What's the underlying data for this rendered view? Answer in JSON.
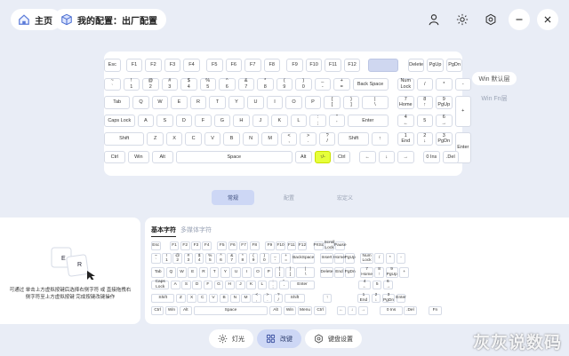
{
  "header": {
    "home_label": "主页",
    "profile_label": "我的配置：出厂配置"
  },
  "icons": {
    "home": "home-icon",
    "profile": "cube-icon",
    "user": "user-icon",
    "brightness": "sun-icon",
    "settings": "gear-icon",
    "minimize": "minimize-icon",
    "close": "close-icon"
  },
  "layers": {
    "active": "Win 默认层",
    "idle": "Win Fn层"
  },
  "tabs": [
    {
      "label": "常规",
      "active": true
    },
    {
      "label": "配置",
      "active": false
    },
    {
      "label": "宏定义",
      "active": false
    }
  ],
  "main_keys": [
    [
      "Esc",
      "F1",
      "F2",
      "F3",
      "F4",
      "F5",
      "F6",
      "F7",
      "F8",
      "F9",
      "F10",
      "F11",
      "F12",
      "",
      "Delete",
      "PgUp",
      "PgDn"
    ],
    [
      "~\n`",
      "!\n1",
      "@\n2",
      "#\n3",
      "$\n4",
      "%\n5",
      "^\n6",
      "&\n7",
      "*\n8",
      "(\n9",
      ")\n0",
      "_\n-",
      "+\n=",
      "Back Space",
      "Num\nLock",
      "/",
      "*",
      "-"
    ],
    [
      "Tab",
      "Q",
      "W",
      "E",
      "R",
      "T",
      "Y",
      "U",
      "I",
      "O",
      "P",
      "{\n[",
      "}\n]",
      "|\n\\",
      "7\nHome",
      "8\n↑",
      "9\nPgUp",
      "+"
    ],
    [
      "Caps Lock",
      "A",
      "S",
      "D",
      "F",
      "G",
      "H",
      "J",
      "K",
      "L",
      ":\n;",
      "\"\n'",
      "Enter",
      "4\n←",
      "5",
      "6\n→"
    ],
    [
      "Shift",
      "Z",
      "X",
      "C",
      "V",
      "B",
      "N",
      "M",
      "<\n,",
      ">\n.",
      "?\n/",
      "Shift",
      "↑",
      "1\nEnd",
      "2\n↓",
      "3\nPgDn",
      "Enter"
    ],
    [
      "Ctrl",
      "Win",
      "Alt",
      "Space",
      "Alt",
      "↑/-",
      "Ctrl",
      "←",
      "↓",
      "→",
      "0 Ins",
      ".Del"
    ]
  ],
  "left_panel": {
    "hint": "可通过 单击上方虚拟按键后选择右侧字符 或 直接拖拽右侧字符至上方虚拟按键 完成按键改键操作",
    "demo_keys": [
      "E",
      "R"
    ]
  },
  "right_panel": {
    "subtabs": [
      "基本字符",
      "多媒体字符"
    ],
    "row1": [
      "Esc",
      "F1",
      "F2",
      "F3",
      "F4",
      "F5",
      "F6",
      "F7",
      "F8",
      "F9",
      "F10",
      "F11",
      "F12",
      "PrtSc",
      "Scroll\nLock",
      "Pause"
    ],
    "row2": [
      "~\n`",
      "!\n1",
      "@\n2",
      "#\n3",
      "$\n4",
      "%\n5",
      "^\n6",
      "&\n7",
      "*\n8",
      "(\n9",
      ")\n0",
      "_\n-",
      "+\n=",
      "BackSpace",
      "Insert",
      "Home",
      "PgUp",
      "Num\nLock",
      "/",
      "*",
      "-"
    ],
    "row3": [
      "Tab",
      "Q",
      "W",
      "E",
      "R",
      "T",
      "Y",
      "U",
      "I",
      "O",
      "P",
      "{\n[",
      "}\n]",
      "|\n\\",
      "Delete",
      "End",
      "PgDn",
      "7\nHome",
      "8\n↑",
      "9\nPgUp",
      "+"
    ],
    "row4": [
      "Caps Lock",
      "A",
      "S",
      "D",
      "F",
      "G",
      "H",
      "J",
      "K",
      "L",
      ":\n;",
      "\"\n'",
      "Enter",
      "4\n←",
      "5",
      "6\n→"
    ],
    "row5": [
      "Shift",
      "Z",
      "X",
      "C",
      "V",
      "B",
      "N",
      "M",
      "<\n,",
      ">\n.",
      "?\n/",
      "Shift",
      "↑",
      "1\nEnd",
      "2\n↓",
      "3\nPgDn",
      "Enter"
    ],
    "row6": [
      "Ctrl",
      "Win",
      "Alt",
      "Space",
      "Alt",
      "Win",
      "Menu",
      "Ctrl",
      "←",
      "↓",
      "→",
      "0 Ins",
      ".Del",
      "Fn"
    ]
  },
  "bottom_nav": [
    {
      "label": "灯光",
      "icon": "sun-icon",
      "active": false
    },
    {
      "label": "改键",
      "icon": "grid-icon",
      "active": true
    },
    {
      "label": "键盘设置",
      "icon": "gear-icon",
      "active": false
    }
  ],
  "watermark": "灰灰说数码"
}
